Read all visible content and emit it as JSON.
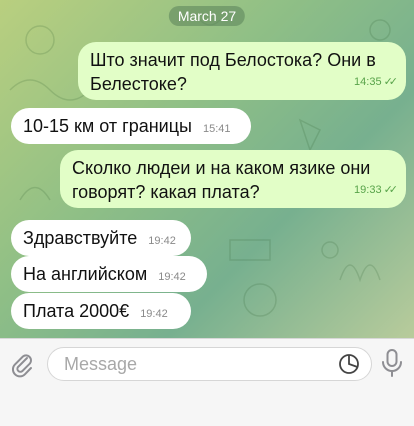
{
  "date_label": "March 27",
  "messages": [
    {
      "direction": "out",
      "text": "Што значит под Белостока? Они в Белестоке?",
      "time": "14:35",
      "read": true
    },
    {
      "direction": "in",
      "text": "10-15 км от границы",
      "time": "15:41"
    },
    {
      "direction": "out",
      "text": "Сколко людеи и на каком язике они говорят? какая плата?",
      "time": "19:33",
      "read": true
    },
    {
      "direction": "in",
      "text": "Здравствуйте",
      "time": "19:42"
    },
    {
      "direction": "in",
      "text": "На английском",
      "time": "19:42"
    },
    {
      "direction": "in",
      "text": "Плата 2000€",
      "time": "19:42"
    }
  ],
  "composer": {
    "placeholder": "Message"
  },
  "icons": {
    "attach": "paperclip-icon",
    "sticker": "sticker-icon",
    "mic": "microphone-icon"
  },
  "colors": {
    "outgoing_bubble": "#e2fec7",
    "incoming_bubble": "#ffffff",
    "accent": "#58a34a"
  }
}
